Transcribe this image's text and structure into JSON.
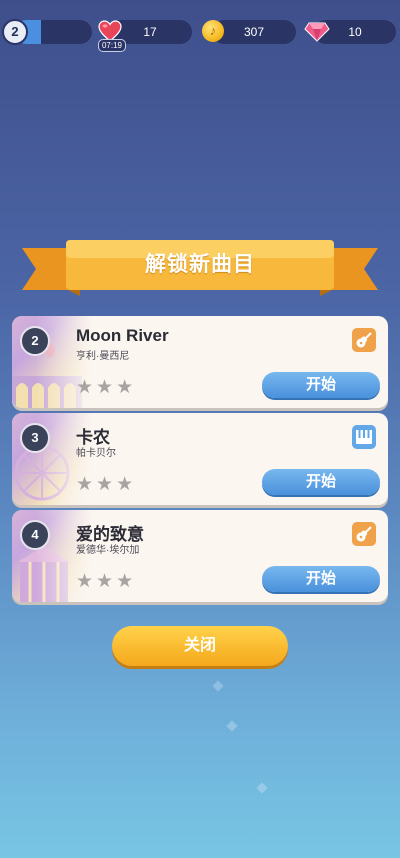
{
  "top_bar": {
    "level": "2",
    "level_progress": 0.35,
    "lives": "17",
    "lives_timer": "07:19",
    "coins": "307",
    "gems": "10"
  },
  "banner": {
    "title": "解锁新曲目"
  },
  "songs": [
    {
      "number": "2",
      "title": "Moon River",
      "artist": "亨利·曼西尼",
      "instrument": "guitar-icon",
      "stars": "★★★",
      "button": "开始"
    },
    {
      "number": "3",
      "title": "卡农",
      "artist": "帕卡贝尔",
      "instrument": "piano-icon",
      "stars": "★★★",
      "button": "开始"
    },
    {
      "number": "4",
      "title": "爱的致意",
      "artist": "爱德华·埃尔加",
      "instrument": "guitar-icon",
      "stars": "★★★",
      "button": "开始"
    }
  ],
  "close_label": "关闭",
  "colors": {
    "banner": "#f6b53a",
    "start_button": "#5ea3e6",
    "close_button": "#f9bf2e",
    "card": "#fbf6f0"
  }
}
